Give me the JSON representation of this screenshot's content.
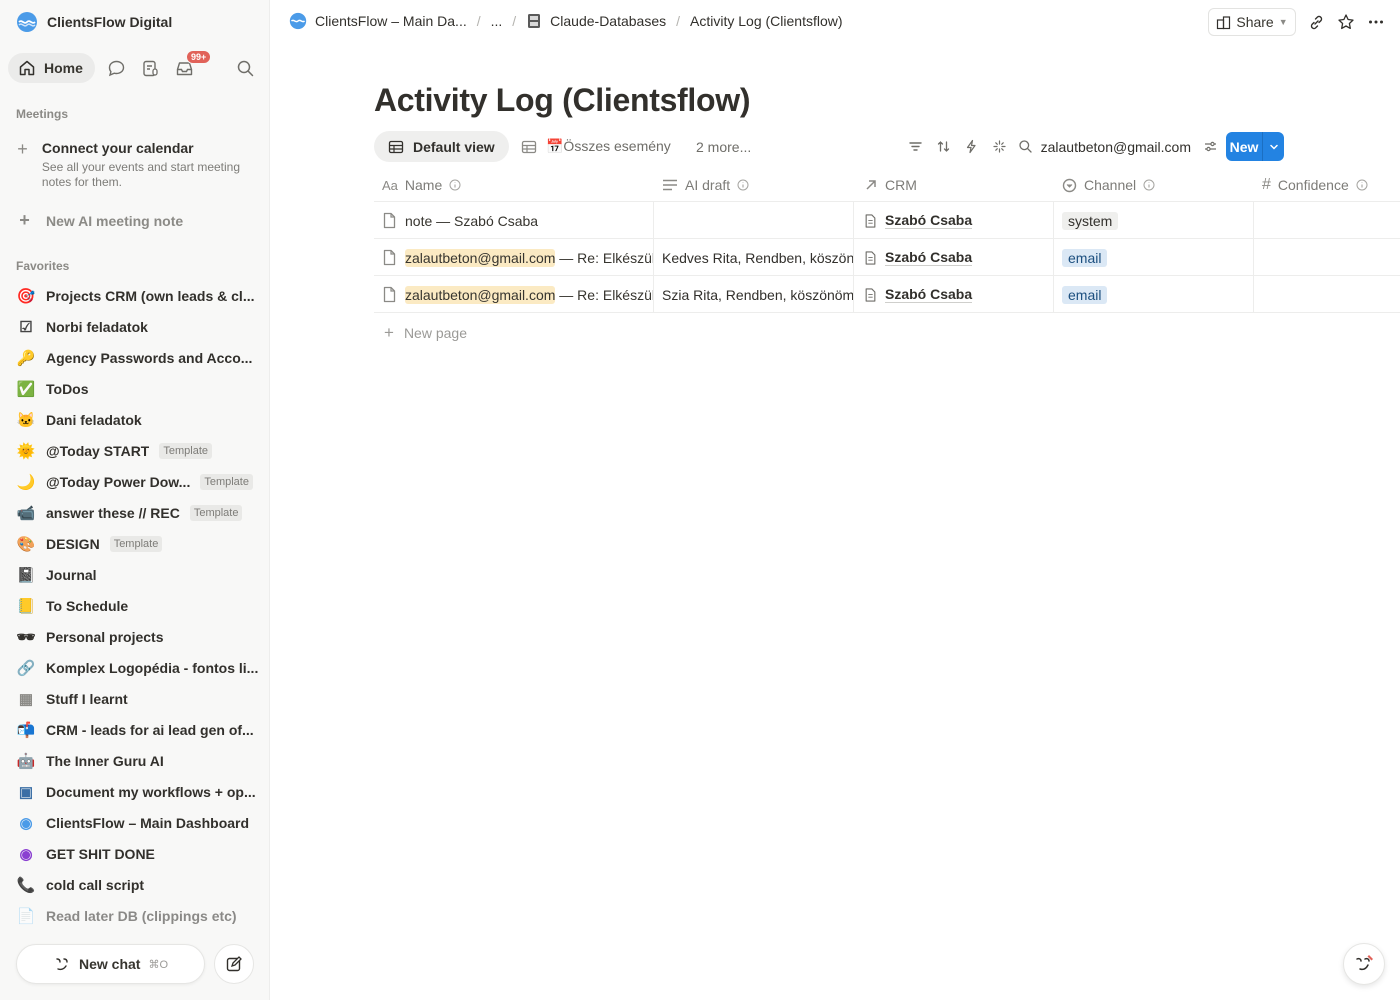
{
  "workspace": {
    "name": "ClientsFlow Digital"
  },
  "nav": {
    "home": "Home",
    "inbox_badge": "99+"
  },
  "meetings": {
    "section": "Meetings",
    "connect_title": "Connect your calendar",
    "connect_desc": "See all your events and start meeting notes for them.",
    "new_note": "New AI meeting note"
  },
  "favorites": {
    "section": "Favorites",
    "items": [
      {
        "label": "Projects CRM (own leads & cl...",
        "icon": "target-icon",
        "template": ""
      },
      {
        "label": "Norbi feladatok",
        "icon": "checkbox-icon",
        "template": ""
      },
      {
        "label": "Agency Passwords and Acco...",
        "icon": "key-icon",
        "template": ""
      },
      {
        "label": "ToDos",
        "icon": "check-mark-icon",
        "template": ""
      },
      {
        "label": "Dani feladatok",
        "icon": "cat-face-icon",
        "template": ""
      },
      {
        "label": "@Today START",
        "icon": "sun-face-icon",
        "template": "Template"
      },
      {
        "label": "@Today Power Dow...",
        "icon": "moon-icon",
        "template": "Template"
      },
      {
        "label": "answer these // REC",
        "icon": "video-camera-icon",
        "template": "Template"
      },
      {
        "label": "DESIGN",
        "icon": "palette-icon",
        "template": "Template"
      },
      {
        "label": "Journal",
        "icon": "notebook-icon",
        "template": ""
      },
      {
        "label": "To Schedule",
        "icon": "ledger-icon",
        "template": ""
      },
      {
        "label": "Personal projects",
        "icon": "sunglasses-icon",
        "template": ""
      },
      {
        "label": "Komplex Logopédia - fontos li...",
        "icon": "link-icon",
        "template": ""
      },
      {
        "label": "Stuff I learnt",
        "icon": "table-icon",
        "template": ""
      },
      {
        "label": "CRM - leads for ai lead gen of...",
        "icon": "mailbox-icon",
        "template": ""
      },
      {
        "label": "The Inner Guru AI",
        "icon": "robot-icon",
        "template": ""
      },
      {
        "label": "Document my workflows + op...",
        "icon": "chip-icon",
        "template": ""
      },
      {
        "label": "ClientsFlow – Main Dashboard",
        "icon": "clientsflow-logo-icon",
        "template": ""
      },
      {
        "label": "GET SHIT DONE",
        "icon": "purple-badge-icon",
        "template": ""
      },
      {
        "label": "cold call script",
        "icon": "phone-icon",
        "template": ""
      },
      {
        "label": "Read later DB (clippings etc)",
        "icon": "document-icon",
        "template": ""
      }
    ]
  },
  "chat": {
    "label": "New chat",
    "shortcut": "⌘O"
  },
  "breadcrumb": {
    "items": [
      "ClientsFlow – Main Da...",
      "...",
      "Claude-Databases",
      "Activity Log (Clientsflow)"
    ]
  },
  "topbar": {
    "share": "Share"
  },
  "page": {
    "title": "Activity Log (Clientsflow)"
  },
  "views": {
    "default": "Default view",
    "second": "📅Összes esemény",
    "more": "2 more..."
  },
  "search": {
    "value": "zalautbeton@gmail.com"
  },
  "new_button": "New",
  "table": {
    "columns": {
      "name": "Name",
      "ai_draft": "AI draft",
      "crm": "CRM",
      "channel": "Channel",
      "confidence": "Confidence"
    },
    "rows": [
      {
        "name_hl": "",
        "name": "note — Szabó Csaba",
        "ai_draft": "",
        "crm": "Szabó Csaba",
        "channel": "system"
      },
      {
        "name_hl": "zalautbeton@gmail.com",
        "name": " — Re: Elkészült",
        "ai_draft": "Kedves Rita, Rendben, köszönöm",
        "crm": "Szabó Csaba",
        "channel": "email"
      },
      {
        "name_hl": "zalautbeton@gmail.com",
        "name": " — Re: Elkészült",
        "ai_draft": "Szia Rita, Rendben, köszönöm",
        "crm": "Szabó Csaba",
        "channel": "email"
      }
    ],
    "new_page": "New page"
  },
  "colors": {
    "accent": "#2383e2",
    "email_tag": "#dbe8f5",
    "system_tag": "#efefed",
    "highlight": "#fbeac3",
    "badge": "#e16259"
  }
}
